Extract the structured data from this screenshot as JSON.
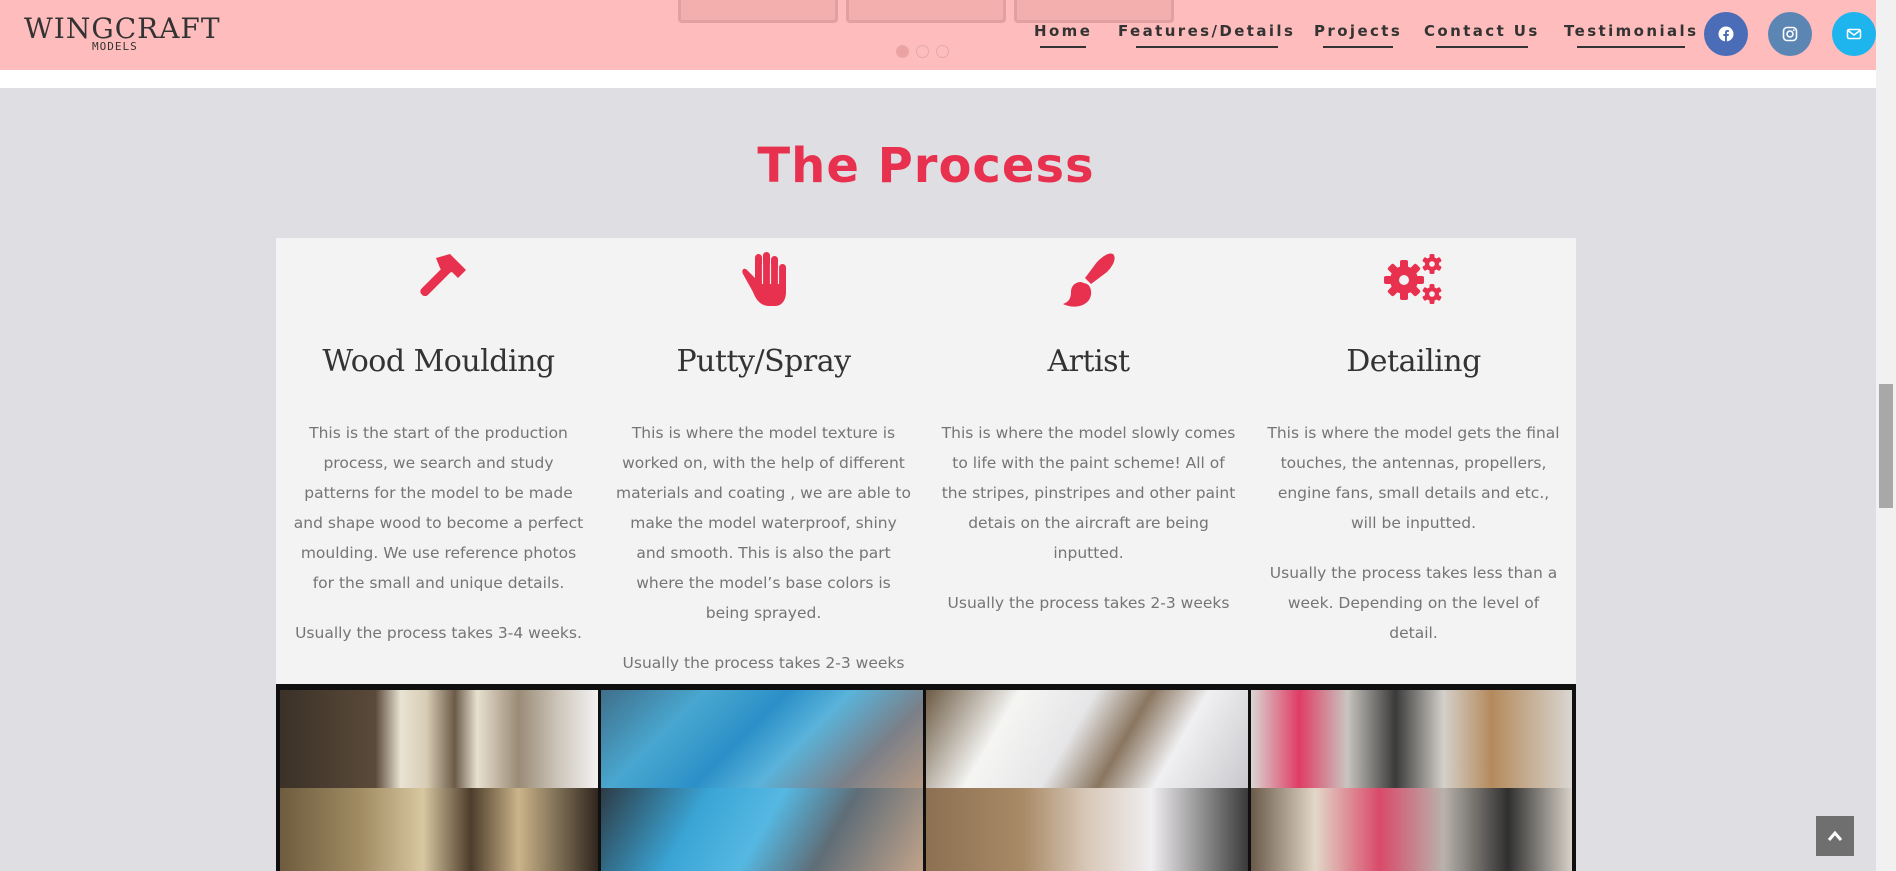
{
  "header": {
    "logo": {
      "main": "WINGCRAFT",
      "sub": "MODELS"
    },
    "nav": [
      {
        "label": "Home"
      },
      {
        "label": "Features/Details"
      },
      {
        "label": "Projects"
      },
      {
        "label": "Contact Us"
      },
      {
        "label": "Testimonials"
      }
    ],
    "social": [
      {
        "icon": "facebook-icon",
        "color": "#4b6cb7"
      },
      {
        "icon": "instagram-icon",
        "color": "#5b86b4"
      },
      {
        "icon": "mail-icon",
        "color": "#1eb5ee"
      }
    ],
    "slider": {
      "slides": 3,
      "active_dot": 1
    }
  },
  "process": {
    "title": "The Process",
    "accent_color": "#e8304f",
    "steps": [
      {
        "icon": "hammer-icon",
        "title": "Wood Moulding",
        "description": "This is the start of the production process, we search and study patterns for the model to be made and shape wood to become a perfect moulding. We use reference photos for the small and unique details.",
        "duration": "Usually the process takes 3-4 weeks."
      },
      {
        "icon": "hand-icon",
        "title": "Putty/Spray",
        "description": "This is where the model texture is worked on, with the help of different materials and coating , we are able to make the model waterproof, shiny and smooth. This is also the part where the model’s base colors is being sprayed.",
        "duration": "Usually the process takes 2-3 weeks"
      },
      {
        "icon": "paint-brush-icon",
        "title": "Artist",
        "description": "This is where the model slowly comes to life with the paint scheme! All of the stripes, pinstripes and other paint detais on the aircraft are being inputted.",
        "duration": "Usually the process takes 2-3 weeks"
      },
      {
        "icon": "gears-icon",
        "title": "Detailing",
        "description": "This is where the model gets the final touches, the antennas, propellers, engine fans, small details and etc., will be inputted.",
        "duration": "Usually the process takes less than a week. Depending on the level of detail."
      }
    ]
  }
}
